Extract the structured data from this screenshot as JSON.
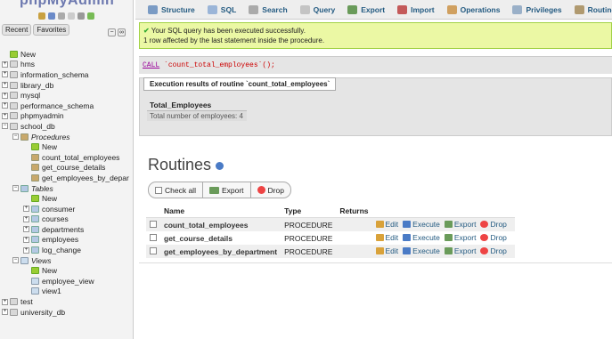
{
  "sidebar": {
    "logo": "phpMyAdmin",
    "nav_tabs": [
      "Recent",
      "Favorites"
    ],
    "tree": [
      {
        "label": "New",
        "icon": "new",
        "indent": 0,
        "expander": ""
      },
      {
        "label": "hms",
        "icon": "db",
        "indent": 0,
        "expander": "+"
      },
      {
        "label": "information_schema",
        "icon": "db",
        "indent": 0,
        "expander": "+"
      },
      {
        "label": "library_db",
        "icon": "db",
        "indent": 0,
        "expander": "+"
      },
      {
        "label": "mysql",
        "icon": "db",
        "indent": 0,
        "expander": "+"
      },
      {
        "label": "performance_schema",
        "icon": "db",
        "indent": 0,
        "expander": "+"
      },
      {
        "label": "phpmyadmin",
        "icon": "db",
        "indent": 0,
        "expander": "+"
      },
      {
        "label": "school_db",
        "icon": "db",
        "indent": 0,
        "expander": "−"
      },
      {
        "label": "Procedures",
        "icon": "proc",
        "indent": 1,
        "expander": "−",
        "italic": true
      },
      {
        "label": "New",
        "icon": "new",
        "indent": 2,
        "expander": ""
      },
      {
        "label": "count_total_employees",
        "icon": "proc",
        "indent": 2,
        "expander": ""
      },
      {
        "label": "get_course_details",
        "icon": "proc",
        "indent": 2,
        "expander": ""
      },
      {
        "label": "get_employees_by_depar",
        "icon": "proc",
        "indent": 2,
        "expander": ""
      },
      {
        "label": "Tables",
        "icon": "table",
        "indent": 1,
        "expander": "−",
        "italic": true
      },
      {
        "label": "New",
        "icon": "new",
        "indent": 2,
        "expander": ""
      },
      {
        "label": "consumer",
        "icon": "table",
        "indent": 2,
        "expander": "+"
      },
      {
        "label": "courses",
        "icon": "table",
        "indent": 2,
        "expander": "+"
      },
      {
        "label": "departments",
        "icon": "table",
        "indent": 2,
        "expander": "+"
      },
      {
        "label": "employees",
        "icon": "table",
        "indent": 2,
        "expander": "+"
      },
      {
        "label": "log_change",
        "icon": "table",
        "indent": 2,
        "expander": "+"
      },
      {
        "label": "Views",
        "icon": "view",
        "indent": 1,
        "expander": "−",
        "italic": true
      },
      {
        "label": "New",
        "icon": "new",
        "indent": 2,
        "expander": ""
      },
      {
        "label": "employee_view",
        "icon": "view",
        "indent": 2,
        "expander": ""
      },
      {
        "label": "view1",
        "icon": "view",
        "indent": 2,
        "expander": ""
      },
      {
        "label": "test",
        "icon": "db",
        "indent": 0,
        "expander": "+"
      },
      {
        "label": "university_db",
        "icon": "db",
        "indent": 0,
        "expander": "+"
      }
    ]
  },
  "topnav": [
    {
      "label": "Structure",
      "icon": "structure-icon",
      "color": "#7a9bc4"
    },
    {
      "label": "SQL",
      "icon": "sql-icon",
      "color": "#9bb5d8"
    },
    {
      "label": "Search",
      "icon": "search-icon",
      "color": "#aaa"
    },
    {
      "label": "Query",
      "icon": "query-icon",
      "color": "#c4c4c4"
    },
    {
      "label": "Export",
      "icon": "export-icon",
      "color": "#6a9b5a"
    },
    {
      "label": "Import",
      "icon": "import-icon",
      "color": "#c45a5a"
    },
    {
      "label": "Operations",
      "icon": "operations-icon",
      "color": "#d0a060"
    },
    {
      "label": "Privileges",
      "icon": "privileges-icon",
      "color": "#9ab0c8"
    },
    {
      "label": "Routine",
      "icon": "routines-icon",
      "color": "#b09a70"
    }
  ],
  "success": {
    "line1": "Your SQL query has been executed successfully.",
    "line2": "1 row affected by the last statement inside the procedure."
  },
  "sql": {
    "keyword": "CALL",
    "rest": "`count_total_employees`();"
  },
  "results": {
    "title": "Execution results of routine `count_total_employees`",
    "column": "Total_Employees",
    "value": "Total number of employees: 4"
  },
  "routines": {
    "title": "Routines",
    "toolbar": [
      "Check all",
      "Export",
      "Drop"
    ],
    "headers": [
      "Name",
      "Type",
      "Returns"
    ],
    "rows": [
      {
        "name": "count_total_employees",
        "type": "PROCEDURE",
        "returns": ""
      },
      {
        "name": "get_course_details",
        "type": "PROCEDURE",
        "returns": ""
      },
      {
        "name": "get_employees_by_department",
        "type": "PROCEDURE",
        "returns": ""
      }
    ],
    "actions": [
      "Edit",
      "Execute",
      "Export",
      "Drop"
    ]
  }
}
